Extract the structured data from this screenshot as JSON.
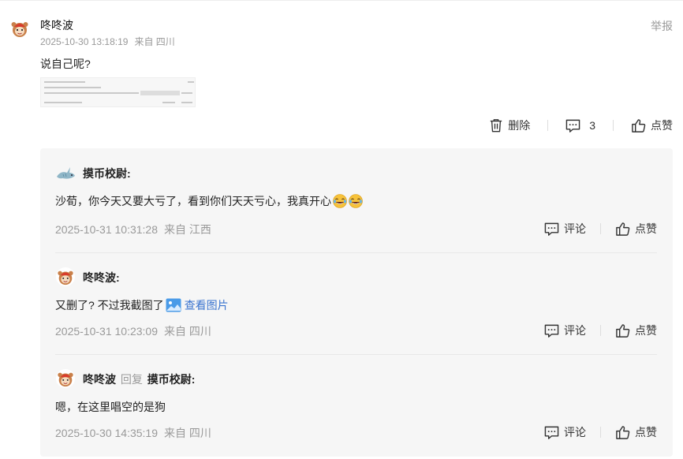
{
  "comment": {
    "author": "咚咚波",
    "timestamp": "2025-10-30 13:18:19",
    "location": "来自 四川",
    "report_label": "举报",
    "text": "说自己呢?",
    "actions": {
      "delete_label": "删除",
      "comment_count": "3",
      "like_label": "点赞"
    }
  },
  "replies": [
    {
      "author": "摸币校尉:",
      "text": "沙荀，你今天又要大亏了，看到你们天天亏心，我真开心",
      "emojis": [
        "laugh-cry-icon",
        "laugh-cry-icon"
      ],
      "timestamp": "2025-10-31 10:31:28",
      "location": "来自 江西",
      "comment_label": "评论",
      "like_label": "点赞"
    },
    {
      "author": "咚咚波:",
      "text": "又删了? 不过我截图了",
      "view_image_label": "查看图片",
      "timestamp": "2025-10-31 10:23:09",
      "location": "来自 四川",
      "comment_label": "评论",
      "like_label": "点赞"
    },
    {
      "author": "咚咚波",
      "reply_word": "回复",
      "reply_to": "摸币校尉:",
      "text": "嗯，在这里唱空的是狗",
      "timestamp": "2025-10-30 14:35:19",
      "location": "来自 四川",
      "comment_label": "评论",
      "like_label": "点赞"
    }
  ]
}
